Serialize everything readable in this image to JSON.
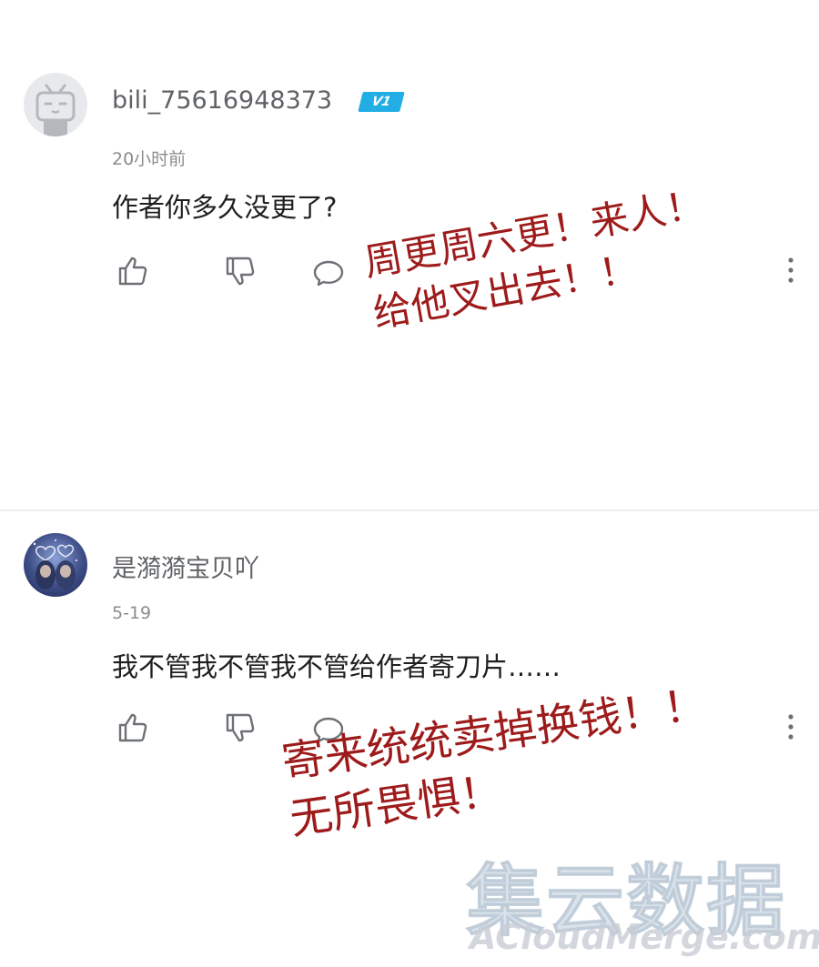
{
  "comments": [
    {
      "username": "bili_75616948373",
      "level_badge": "V1",
      "timestamp": "20小时前",
      "text": "作者你多久没更了?",
      "avatar_icon": "bilibili-tv-icon",
      "actions": [
        "like-icon",
        "dislike-icon",
        "reply-icon",
        "more-icon"
      ]
    },
    {
      "username": "是漪漪宝贝吖",
      "timestamp": "5-19",
      "text": "我不管我不管我不管给作者寄刀片……",
      "avatar_icon": "user-photo-avatar",
      "actions": [
        "like-icon",
        "dislike-icon",
        "reply-icon",
        "more-icon"
      ]
    }
  ],
  "annotations": [
    {
      "lines": [
        "周更周六更！来人！",
        "给他叉出去！！"
      ]
    },
    {
      "lines": [
        "寄来统统卖掉换钱！！",
        "无所畏惧！"
      ]
    }
  ],
  "watermark": {
    "cn": "集云数据",
    "en": "ACloudMerge.com"
  },
  "colors": {
    "annotation": "#9e1b1b",
    "badge": "#23ade5",
    "icon": "#6d7075",
    "divider": "#eeeeee"
  }
}
